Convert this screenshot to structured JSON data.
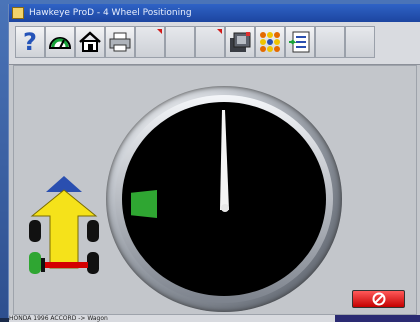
{
  "window": {
    "title": "Hawkeye ProD - 4 Wheel Positioning"
  },
  "toolbar": {
    "buttons": [
      {
        "name": "help",
        "icon": "question-mark-icon"
      },
      {
        "name": "gauge",
        "icon": "gauge-icon"
      },
      {
        "name": "home",
        "icon": "home-icon"
      },
      {
        "name": "print",
        "icon": "printer-icon"
      },
      {
        "name": "empty-1",
        "icon": ""
      },
      {
        "name": "empty-2",
        "icon": ""
      },
      {
        "name": "empty-3",
        "icon": ""
      },
      {
        "name": "camera",
        "icon": "camera-icon"
      },
      {
        "name": "dots",
        "icon": "dots-grid-icon"
      },
      {
        "name": "list",
        "icon": "checklist-icon"
      },
      {
        "name": "empty-4",
        "icon": ""
      },
      {
        "name": "empty-5",
        "icon": ""
      }
    ]
  },
  "gauge": {
    "needle_value": 0
  },
  "status": {
    "vehicle_text": "HONDA  1996  ACCORD  ->  Wagon"
  },
  "colors": {
    "title_bar": "#1d45a0",
    "marker_green": "#2fa632",
    "arrow_yellow": "#f5e21a",
    "arrow_blue": "#2a4fb0",
    "stop_red": "#d40000"
  }
}
